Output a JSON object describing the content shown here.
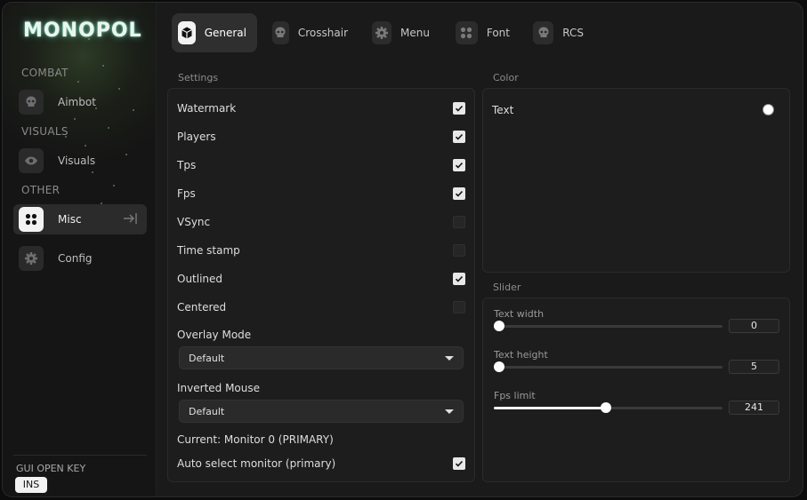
{
  "app": {
    "logo": "MONOPOL"
  },
  "sidebar": {
    "categories": [
      {
        "label": "COMBAT"
      },
      {
        "label": "VISUALS"
      },
      {
        "label": "OTHER"
      }
    ],
    "items": [
      {
        "label": "Aimbot",
        "icon": "skull-icon"
      },
      {
        "label": "Visuals",
        "icon": "eye-icon"
      },
      {
        "label": "Misc",
        "icon": "four-dots-icon",
        "active": true
      },
      {
        "label": "Config",
        "icon": "gear-icon"
      }
    ],
    "gui_key": {
      "label": "GUI OPEN KEY",
      "value": "INS"
    }
  },
  "tabs": [
    {
      "label": "General",
      "icon": "cube-icon",
      "active": true
    },
    {
      "label": "Crosshair",
      "icon": "skull-icon"
    },
    {
      "label": "Menu",
      "icon": "gear-icon"
    },
    {
      "label": "Font",
      "icon": "four-dots-icon"
    },
    {
      "label": "RCS",
      "icon": "skull-icon"
    }
  ],
  "settings": {
    "title": "Settings",
    "toggles": [
      {
        "label": "Watermark",
        "checked": true
      },
      {
        "label": "Players",
        "checked": true
      },
      {
        "label": "Tps",
        "checked": true
      },
      {
        "label": "Fps",
        "checked": true
      },
      {
        "label": "VSync",
        "checked": false
      },
      {
        "label": "Time stamp",
        "checked": false
      },
      {
        "label": "Outlined",
        "checked": true
      },
      {
        "label": "Centered",
        "checked": false
      }
    ],
    "overlay_mode": {
      "label": "Overlay Mode",
      "value": "Default"
    },
    "inverted_mouse": {
      "label": "Inverted Mouse",
      "value": "Default"
    },
    "current_monitor": "Current: Monitor 0 (PRIMARY)",
    "auto_select": {
      "label": "Auto select monitor (primary)",
      "checked": true
    }
  },
  "color": {
    "title": "Color",
    "items": [
      {
        "label": "Text",
        "color": "#ffffff"
      }
    ]
  },
  "slider": {
    "title": "Slider",
    "items": [
      {
        "label": "Text width",
        "value": "0",
        "fraction": 0.0
      },
      {
        "label": "Text height",
        "value": "5",
        "fraction": 0.0
      },
      {
        "label": "Fps limit",
        "value": "241",
        "fraction": 0.49
      }
    ]
  },
  "colors": {
    "accent": "#f2f2f2",
    "panel": "#1d1d1d",
    "background": "#1a1a1a"
  }
}
